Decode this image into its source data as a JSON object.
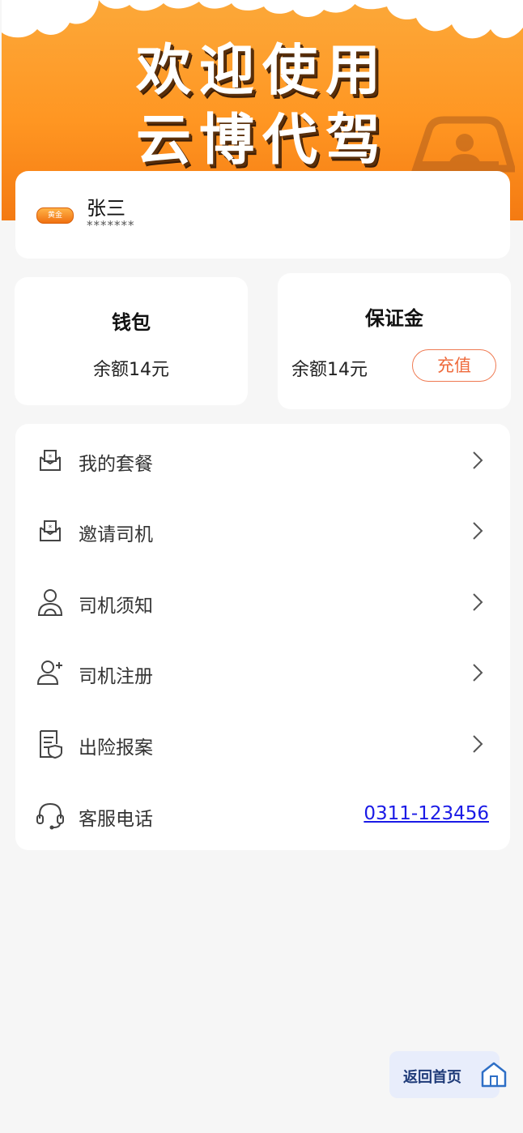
{
  "banner": {
    "line1": "欢迎使用",
    "line2": "云博代驾"
  },
  "profile": {
    "badge": "黄金",
    "name": "张三",
    "phone": "*******"
  },
  "wallet": {
    "title": "钱包",
    "balance": "余额14元"
  },
  "deposit": {
    "title": "保证金",
    "balance": "余额14元",
    "recharge_label": "充值"
  },
  "menu": {
    "items": [
      {
        "label": "我的套餐",
        "icon": "envelope-star-icon"
      },
      {
        "label": "邀请司机",
        "icon": "envelope-star-icon"
      },
      {
        "label": "司机须知",
        "icon": "driver-icon"
      },
      {
        "label": "司机注册",
        "icon": "add-user-icon"
      },
      {
        "label": "出险报案",
        "icon": "insurance-document-icon"
      },
      {
        "label": "客服电话",
        "icon": "headset-icon"
      }
    ],
    "service_phone": "0311-123456"
  },
  "home_button": {
    "label": "返回首页",
    "icon": "home-icon"
  },
  "colors": {
    "banner_orange": "#ff9622",
    "accent": "#ef6b3d",
    "link": "#1a1ae6"
  }
}
